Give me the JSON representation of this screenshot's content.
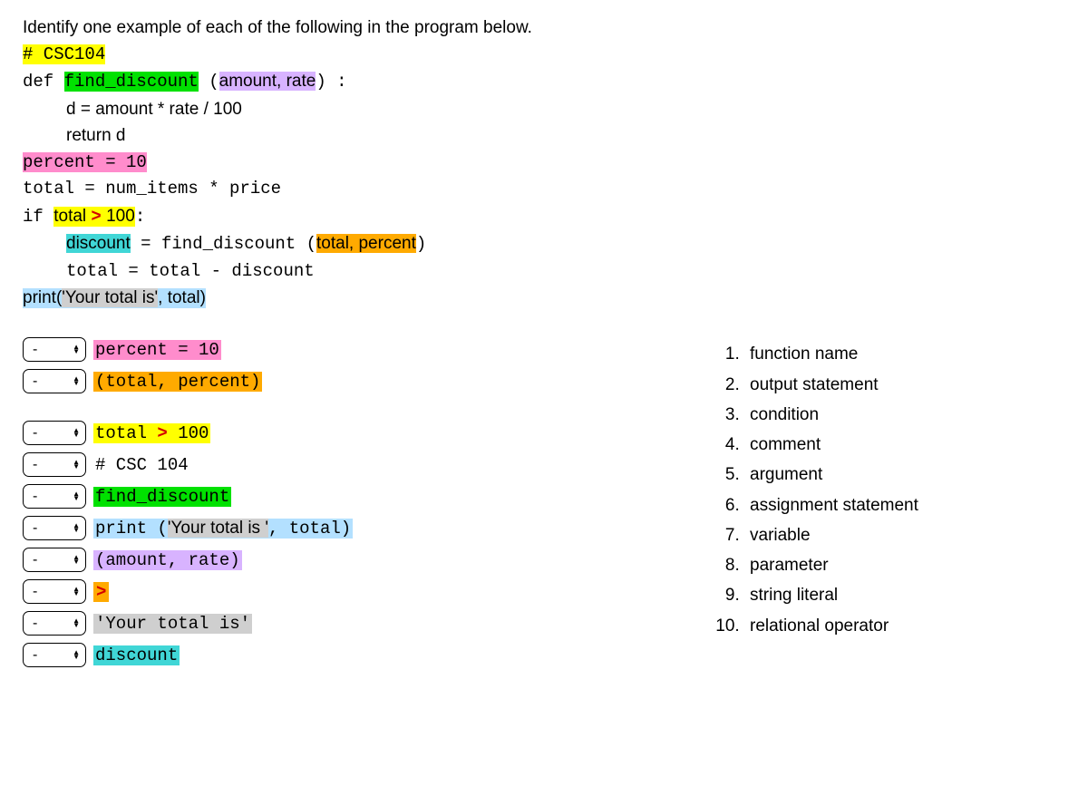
{
  "prompt": "Identify one example of each of the following in the program below.",
  "code": {
    "l1": "# CSC104",
    "l2a": "def ",
    "l2b": "find_discount",
    "l2c": " (",
    "l2d": "amount, rate",
    "l2e": ") :",
    "l3": "d = amount * rate / 100",
    "l4": "return d",
    "l5": "percent = 10",
    "l6": "total = num_items * price",
    "l7a": "if ",
    "l7b": "total ",
    "l7c": ">",
    "l7d": " 100",
    "l7e": ":",
    "l8a": "discount",
    "l8b": " = find_discount (",
    "l8c": "total, percent",
    "l8d": ")",
    "l9": "total = total - discount",
    "l10a": "print(",
    "l10b": "'Your total is'",
    "l10c": ", total)"
  },
  "selector_value": "-",
  "matches": [
    {
      "text": "percent = 10",
      "hl": "hl-pink"
    },
    {
      "text": "(total, percent) ",
      "hl": "hl-orange"
    },
    {
      "text_parts": [
        {
          "t": "total ",
          "hl": ""
        },
        {
          "t": ">",
          "hl": "hl-red"
        },
        {
          "t": " 100",
          "hl": ""
        }
      ],
      "hl": "hl-yellow"
    },
    {
      "text": "# CSC 104",
      "hl": ""
    },
    {
      "text": "find_discount ",
      "hl": "hl-green"
    },
    {
      "text_parts": [
        {
          "t": "print (",
          "hl": ""
        },
        {
          "t": "'Your total is '",
          "hl": "hl-grey-inner"
        },
        {
          "t": ", total) ",
          "hl": ""
        }
      ],
      "hl": "hl-ltblue"
    },
    {
      "text": "(amount, rate) ",
      "hl": "hl-purple"
    },
    {
      "text": ">",
      "hl": "hl-red-solo"
    },
    {
      "text": "'Your total is' ",
      "hl": "hl-grey"
    },
    {
      "text": "discount ",
      "hl": "hl-cyan"
    }
  ],
  "answers": [
    "function name",
    "output statement",
    "condition",
    "comment",
    "argument",
    "assignment statement",
    "variable",
    "parameter",
    "string literal",
    "relational operator"
  ]
}
